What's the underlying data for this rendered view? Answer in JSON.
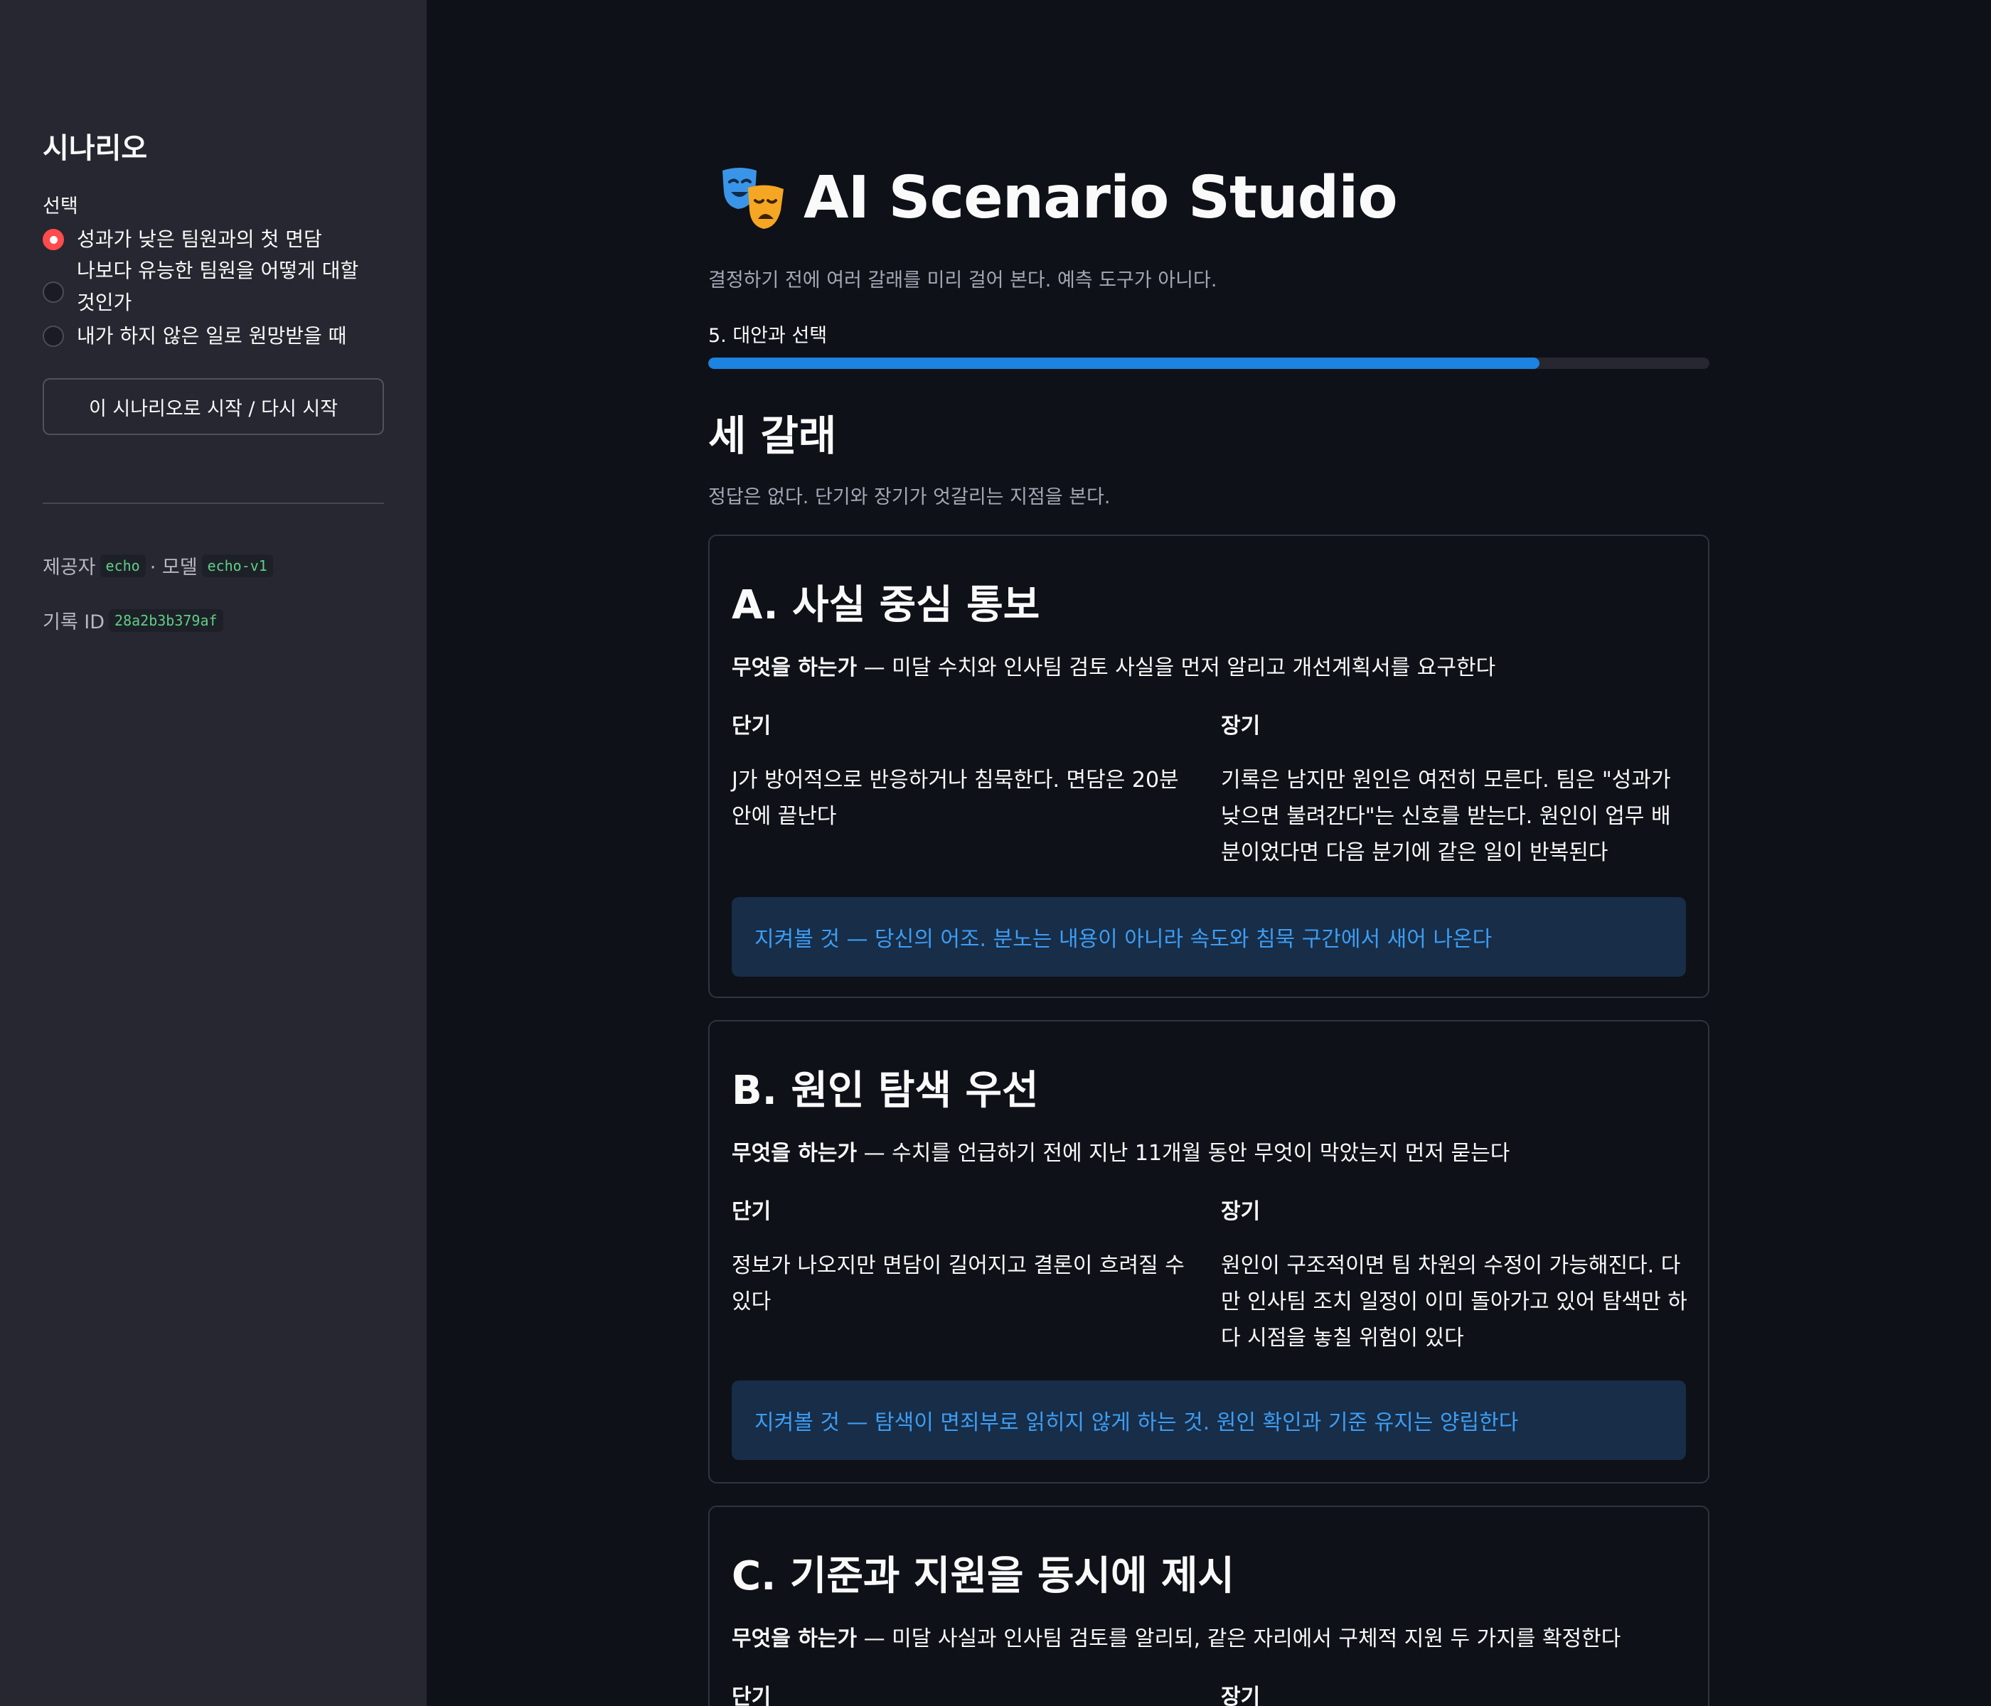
{
  "sidebar": {
    "title": "시나리오",
    "select_label": "선택",
    "options": [
      {
        "label": "성과가 낮은 팀원과의 첫 면담",
        "selected": true
      },
      {
        "label": "나보다 유능한 팀원을 어떻게 대할 것인가",
        "selected": false
      },
      {
        "label": "내가 하지 않은 일로 원망받을 때",
        "selected": false
      }
    ],
    "start_button": "이 시나리오로 시작 / 다시 시작",
    "provider_label": "제공자",
    "provider_value": "echo",
    "model_sep": "· 모델",
    "model_value": "echo-v1",
    "record_label": "기록 ID",
    "record_value": "28a2b3b379af"
  },
  "header": {
    "icon": "performing-arts-masks-icon",
    "title": "AI Scenario Studio",
    "subtitle": "결정하기 전에 여러 갈래를 미리 걸어 본다. 예측 도구가 아니다."
  },
  "progress": {
    "label": "5. 대안과 선택",
    "fraction": 0.83,
    "color": "#1c83e1"
  },
  "section": {
    "title": "세 갈래",
    "caption": "정답은 없다. 단기와 장기가 엇갈리는 지점을 본다."
  },
  "labels": {
    "what": "무엇을 하는가",
    "short": "단기",
    "long": "장기"
  },
  "options": [
    {
      "title": "A. 사실 중심 통보",
      "what": " — 미달 수치와 인사팀 검토 사실을 먼저 알리고 개선계획서를 요구한다",
      "short_text": "J가 방어적으로 반응하거나 침묵한다. 면담은 20분 안에 끝난다",
      "long_text": "기록은 남지만 원인은 여전히 모른다. 팀은 \"성과가 낮으면 불려간다\"는 신호를 받는다. 원인이 업무 배분이었다면 다음 분기에 같은 일이 반복된다",
      "watch": "지켜볼 것 — 당신의 어조. 분노는 내용이 아니라 속도와 침묵 구간에서 새어 나온다"
    },
    {
      "title": "B. 원인 탐색 우선",
      "what": " — 수치를 언급하기 전에 지난 11개월 동안 무엇이 막았는지 먼저 묻는다",
      "short_text": "정보가 나오지만 면담이 길어지고 결론이 흐려질 수 있다",
      "long_text": "원인이 구조적이면 팀 차원의 수정이 가능해진다. 다만 인사팀 조치 일정이 이미 돌아가고 있어 탐색만 하다 시점을 놓칠 위험이 있다",
      "watch": "지켜볼 것 — 탐색이 면죄부로 읽히지 않게 하는 것. 원인 확인과 기준 유지는 양립한다"
    },
    {
      "title": "C. 기준과 지원을 동시에 제시",
      "what": " — 미달 사실과 인사팀 검토를 알리되, 같은 자리에서 구체적 지원 두 가지를 확정한다",
      "short_text": "",
      "long_text": "",
      "watch": ""
    }
  ],
  "colors": {
    "accent": "#ff4b4b",
    "info_bg": "#172d48",
    "info_text": "#3d9df3"
  }
}
